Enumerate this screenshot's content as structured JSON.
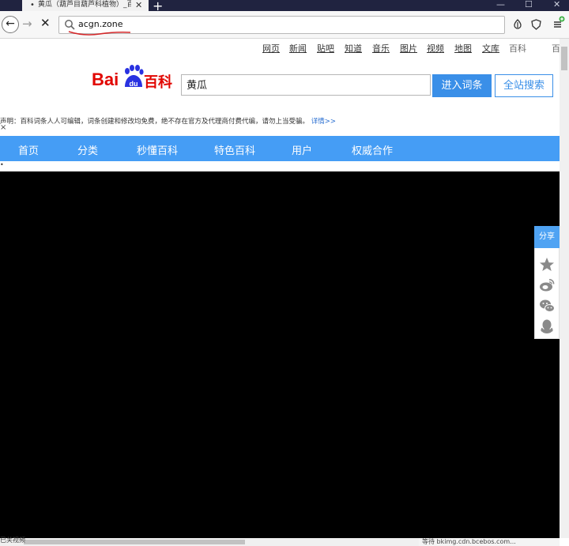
{
  "browser": {
    "tab_title": "黄瓜（葫芦目葫芦科植物）_百度百科",
    "tab_bullet": "•",
    "tab_close": "✕",
    "new_tab": "+",
    "win_minimize": "—",
    "win_maximize": "☐",
    "win_close": "✕",
    "back": "←",
    "forward": "→",
    "stop": "✕",
    "url": "acgn.zone",
    "icons": [
      "back-icon",
      "forward-icon",
      "stop-icon",
      "search-icon",
      "extension-icon",
      "shield-icon",
      "menu-icon"
    ]
  },
  "toplinks": [
    {
      "label": "网页"
    },
    {
      "label": "新闻"
    },
    {
      "label": "贴吧"
    },
    {
      "label": "知道"
    },
    {
      "label": "音乐"
    },
    {
      "label": "图片"
    },
    {
      "label": "视频"
    },
    {
      "label": "地图"
    },
    {
      "label": "文库"
    },
    {
      "label": "百科"
    },
    {
      "label": "百"
    }
  ],
  "logo": {
    "bai": "Bai",
    "du": "du",
    "baike": "百科",
    "color": "#e10601"
  },
  "search": {
    "value": "黄瓜",
    "enter_label": "进入词条",
    "site_label": "全站搜索"
  },
  "disclaimer": {
    "text": "声明：百科词条人人可编辑，词条创建和修改均免费，绝不存在官方及代理商付费代编，请勿上当受骗。",
    "more": "详情>>",
    "close": "×"
  },
  "nav": {
    "items": [
      "首页",
      "分类",
      "秒懂百科",
      "特色百科",
      "用户",
      "权威合作"
    ],
    "bullet": "•",
    "color": "#459df5"
  },
  "share": {
    "title": "分享",
    "icons": [
      "star-icon",
      "weibo-icon",
      "wechat-icon",
      "qq-icon"
    ]
  },
  "status": {
    "left": "已关视频",
    "right": "等待 bkimg.cdn.bcebos.com..."
  }
}
